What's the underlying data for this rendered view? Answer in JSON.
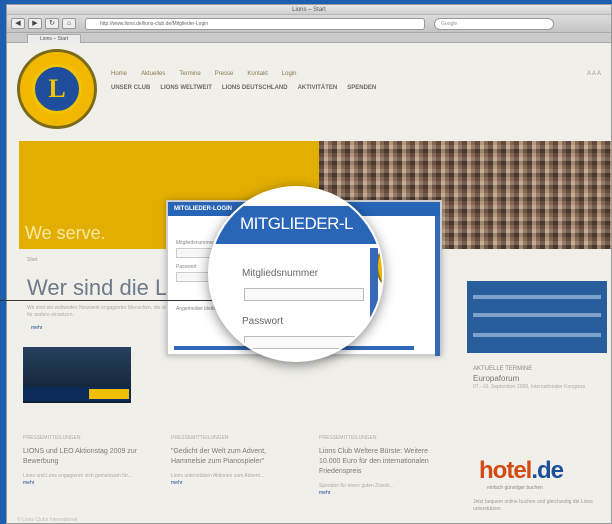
{
  "browser": {
    "window_title": "Lions – Start",
    "url": "http://www.lions.de/lions-club.de/Mitglieder-Login",
    "search_placeholder": "Google",
    "tab_label": "Lions – Start"
  },
  "site": {
    "topnav": [
      "Home",
      "Aktuelles",
      "Termine",
      "Presse",
      "Kontakt",
      "Login"
    ],
    "mainnav": [
      "UNSER CLUB",
      "LIONS WELTWEIT",
      "LIONS DEUTSCHLAND",
      "AKTIVITÄTEN",
      "SPENDEN"
    ],
    "topright": "A A A",
    "banner_text": "We serve.",
    "breadcrumb": "Start",
    "headline": "Wer sind die L",
    "intro": "Wir sind ein weltweites Netzwerk engagierter Menschen, die sich für andere einsetzen.",
    "more": "mehr",
    "columns": [
      {
        "label": "PRESSEMITTEILUNGEN",
        "title": "LIONS und LEO Aktionstag 2009 zur Bewerbung",
        "body": "Lions und Leos engagieren sich gemeinsam für...",
        "more": "mehr"
      },
      {
        "label": "PRESSEMITTEILUNGEN",
        "title": "\"Gedicht der Welt zum Advent, Hammelsie zum Pianospieler\"",
        "body": "Lions unterstützen Aktionen zum Advent...",
        "more": "mehr"
      },
      {
        "label": "PRESSEMITTEILUNGEN",
        "title": "Lions Club Weltere Bürste: Weitere 10.000 Euro für den internationalen Friedenspreis",
        "body": "Spenden für einen guten Zweck...",
        "more": "mehr"
      }
    ],
    "sidebar_event_label": "AKTUELLE TERMINE",
    "sidebar_event_title": "Europaforum",
    "sidebar_event_body": "07.–10. September 2009, Internationaler Kongress",
    "hotel_brand": "hotel",
    "hotel_tld": ".de",
    "hotel_sub": "einfach günstiger buchen",
    "hotel_txt": "Jetzt bequem online buchen und gleichzeitig die Lions unterstützen.",
    "footer": "© Lions Clubs International"
  },
  "modal": {
    "header": "MITGLIEDER-LOGIN",
    "row1": "Mitgliedsnummer",
    "row2": "Passwort",
    "row3": "Angemeldet bleiben"
  },
  "magnifier": {
    "title": "MITGLIEDER-L",
    "label_member": "Mitgliedsnummer",
    "label_password": "Passwort",
    "logo_letter": "L"
  },
  "logo_letter": "L",
  "colors": {
    "lions_blue": "#1e4e9c",
    "lions_gold": "#f2b800",
    "hotel_orange": "#d24a14"
  }
}
